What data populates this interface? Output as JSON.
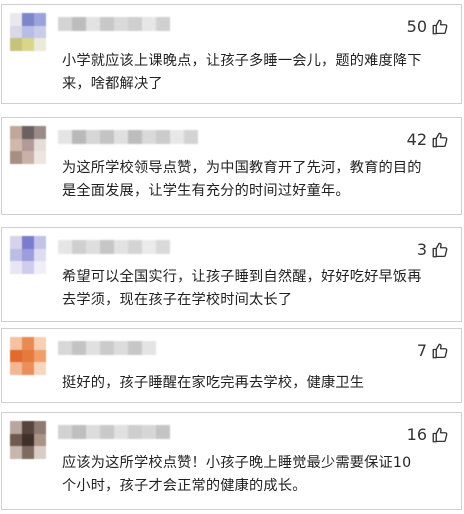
{
  "comments": [
    {
      "likes": "50",
      "text": "小学就应该上课晚点，让孩子多睡一会儿，题的难度降下\n来，啥都解决了",
      "avatar_colors": [
        "#e8e8ee",
        "#7c86c8",
        "#9aa3dc",
        "#d8d8e6",
        "#b8bde6",
        "#c9cde8",
        "#c6c47a",
        "#d9d68a",
        "#eceada"
      ],
      "name_colors": [
        "#d4d4d4",
        "#bdbdbd",
        "#e2e2e2",
        "#c8c8c8",
        "#dadada",
        "#cfcfcf",
        "#e6e6e6",
        "#d0d0d0"
      ]
    },
    {
      "likes": "42",
      "text": "为这所学校领导点赞，为中国教育开了先河，教育的目的\n是全面发展，让学生有充分的时间过好童年。",
      "avatar_colors": [
        "#bfa79a",
        "#6c6062",
        "#9b8b86",
        "#d2b8ac",
        "#b19a98",
        "#e5ddd8",
        "#a88f83",
        "#c9b1a8",
        "#ece6e2"
      ],
      "name_colors": [
        "#e4e4e4",
        "#b9b9b9",
        "#d6d6d6",
        "#c4c4c4",
        "#e0e0e0",
        "#bdbdbd",
        "#d9d9d9",
        "#cbcbcb",
        "#e8e8e8",
        "#d3d3d3"
      ]
    },
    {
      "likes": "3",
      "text": "希望可以全国实行，让孩子睡到自然醒，好好吃好早饭再\n去学须，现在孩子在学校时间太长了",
      "avatar_colors": [
        "#d7d2ec",
        "#7a7ccd",
        "#c3c2e9",
        "#bcbde6",
        "#9c9ddc",
        "#dedcf1",
        "#e8e6f4",
        "#cfcdee",
        "#f0eef8"
      ],
      "name_colors": [
        "#e6e6e6",
        "#cfcfcf",
        "#dedede",
        "#c6c6c6",
        "#e2e2e2",
        "#d4d4d4",
        "#ebebeb",
        "#d9d9d9"
      ]
    },
    {
      "likes": "7",
      "text": "挺好的，孩子睡醒在家吃完再去学校，健康卫生",
      "avatar_colors": [
        "#f3c2a0",
        "#e88a52",
        "#f6d0b4",
        "#e26a2a",
        "#e47a3c",
        "#ef9e6c",
        "#f2b894",
        "#ec8e5a",
        "#f7d6c0"
      ],
      "name_colors": [
        "#d8d8d8",
        "#c3c3c3",
        "#e0e0e0",
        "#cbcbcb",
        "#dcdcdc",
        "#c7c7c7",
        "#e4e4e4"
      ]
    },
    {
      "likes": "16",
      "text": "应该为这所学校点赞！小孩子晚上睡觉最少需要保证10\n个小时，孩子才会正常的健康的成长。",
      "avatar_colors": [
        "#b7a79f",
        "#56443e",
        "#8e7a70",
        "#6e5a50",
        "#3f302b",
        "#a99286",
        "#c5b6ae",
        "#7f6a60",
        "#d8ccc6"
      ],
      "name_colors": [
        "#d2d2d2",
        "#bfbfbf",
        "#dcdcdc",
        "#c9c9c9",
        "#e1e1e1",
        "#cecece",
        "#d7d7d7",
        "#c4c4c4"
      ]
    }
  ],
  "icons": {
    "like": "thumbs-up-icon"
  }
}
